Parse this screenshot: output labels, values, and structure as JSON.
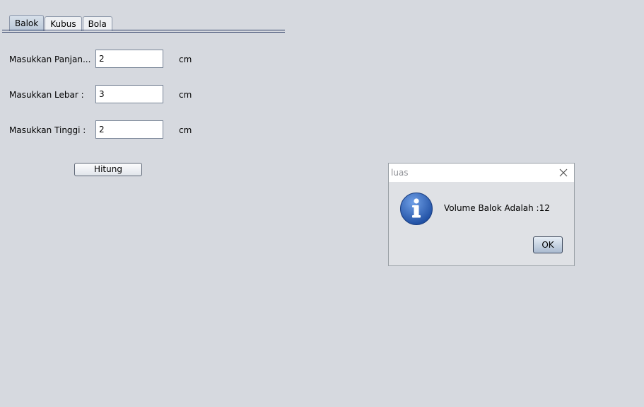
{
  "tabs": [
    {
      "label": "Balok",
      "active": true
    },
    {
      "label": "Kubus",
      "active": false
    },
    {
      "label": "Bola",
      "active": false
    }
  ],
  "form": {
    "rows": [
      {
        "label": "Masukkan Panjan...",
        "value": "2",
        "unit": "cm"
      },
      {
        "label": "Masukkan Lebar :",
        "value": "3",
        "unit": "cm"
      },
      {
        "label": "Masukkan Tinggi :",
        "value": "2",
        "unit": "cm"
      }
    ],
    "submit_label": "Hitung"
  },
  "dialog": {
    "title": "luas",
    "message": "Volume Balok Adalah :12",
    "ok_label": "OK",
    "icon": "info-icon",
    "close_icon": "close-icon"
  },
  "colors": {
    "background": "#d6d9df",
    "tab_rule": "#2f3e66",
    "info_icon": "#2d62b4"
  }
}
